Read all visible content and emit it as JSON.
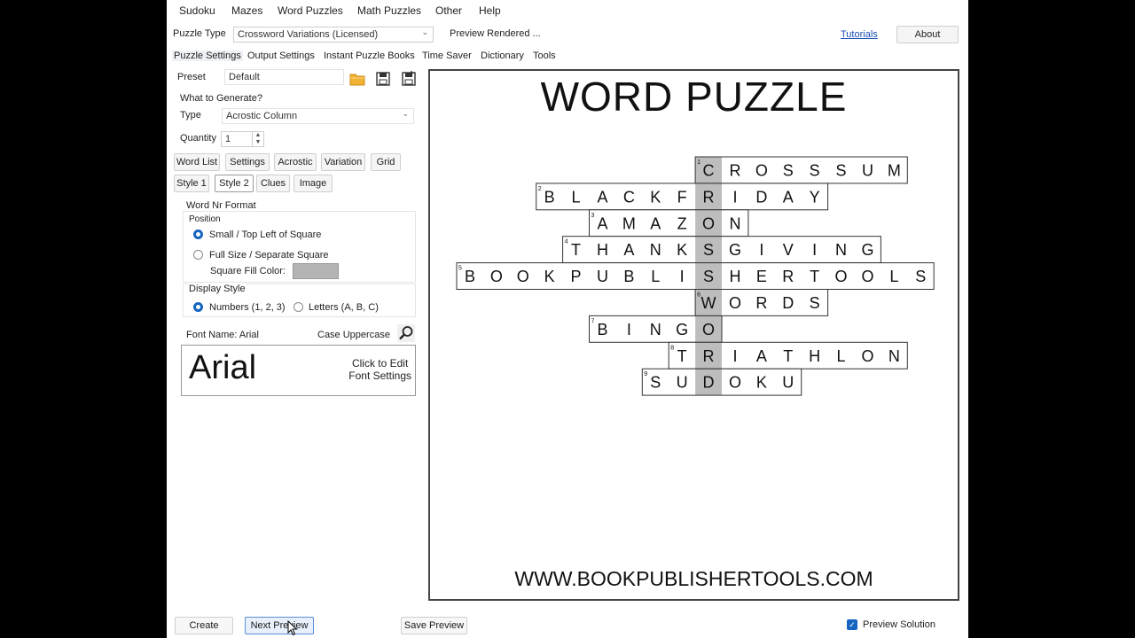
{
  "menu": [
    "Sudoku",
    "Mazes",
    "Word Puzzles",
    "Math Puzzles",
    "Other",
    "Help"
  ],
  "puzzle_type": {
    "label": "Puzzle Type",
    "value": "Crossword Variations (Licensed)",
    "preview_status": "Preview Rendered ..."
  },
  "links": {
    "tutorials": "Tutorials",
    "about": "About"
  },
  "tabs": [
    "Puzzle Settings",
    "Output Settings",
    "Instant Puzzle Books",
    "Time Saver",
    "Dictionary",
    "Tools"
  ],
  "preset": {
    "label": "Preset",
    "value": "Default"
  },
  "what_to_generate": "What to Generate?",
  "type": {
    "label": "Type",
    "value": "Acrostic Column"
  },
  "quantity": {
    "label": "Quantity",
    "value": "1"
  },
  "sub_tabs_row1": [
    "Word List",
    "Settings",
    "Acrostic",
    "Variation",
    "Grid"
  ],
  "sub_tabs_row2": [
    "Style 1",
    "Style 2",
    "Clues",
    "Image"
  ],
  "word_nr": {
    "title": "Word Nr Format",
    "position_label": "Position",
    "option_small": "Small / Top Left of Square",
    "option_full": "Full Size / Separate Square",
    "fill_label": "Square Fill Color:",
    "fill_color": "#b4b4b4"
  },
  "display_style": {
    "title": "Display Style",
    "option_numbers": "Numbers (1, 2, 3)",
    "option_letters": "Letters (A, B, C)"
  },
  "font": {
    "name_label": "Font Name: Arial",
    "case_label": "Case Uppercase",
    "sample": "Arial",
    "edit_line1": "Click to Edit",
    "edit_line2": "Font Settings"
  },
  "bottom": {
    "create": "Create",
    "next_preview": "Next Preview",
    "save_preview": "Save Preview",
    "preview_solution": "Preview Solution"
  },
  "colors": {
    "accent": "#1565c0",
    "link": "#1a4fb5",
    "highlight": "#bdbdbd",
    "folder": "#f2b233"
  },
  "icons": [
    "open-folder-icon",
    "save-icon",
    "save-as-icon",
    "search-icon",
    "chevron-down-icon",
    "spin-arrows-icon",
    "check-icon",
    "cursor-icon"
  ],
  "puzzle": {
    "title": "WORD PUZZLE",
    "url": "WWW.BOOKPUBLISHERTOOLS.COM",
    "key_column": 9,
    "rows": [
      {
        "num": "1",
        "start": 9,
        "word": "CROSSSUM"
      },
      {
        "num": "2",
        "start": 3,
        "word": "BLACKFRIDAY"
      },
      {
        "num": "3",
        "start": 5,
        "word": "AMAZON"
      },
      {
        "num": "4",
        "start": 4,
        "word": "THANKSGIVING"
      },
      {
        "num": "5",
        "start": 0,
        "word": "BOOKPUBLISHERTOOLS"
      },
      {
        "num": "6",
        "start": 9,
        "word": "WORDS"
      },
      {
        "num": "7",
        "start": 5,
        "word": "BINGO"
      },
      {
        "num": "8",
        "start": 8,
        "word": "TRIATHLON"
      },
      {
        "num": "9",
        "start": 7,
        "word": "SUDOKU"
      }
    ]
  }
}
